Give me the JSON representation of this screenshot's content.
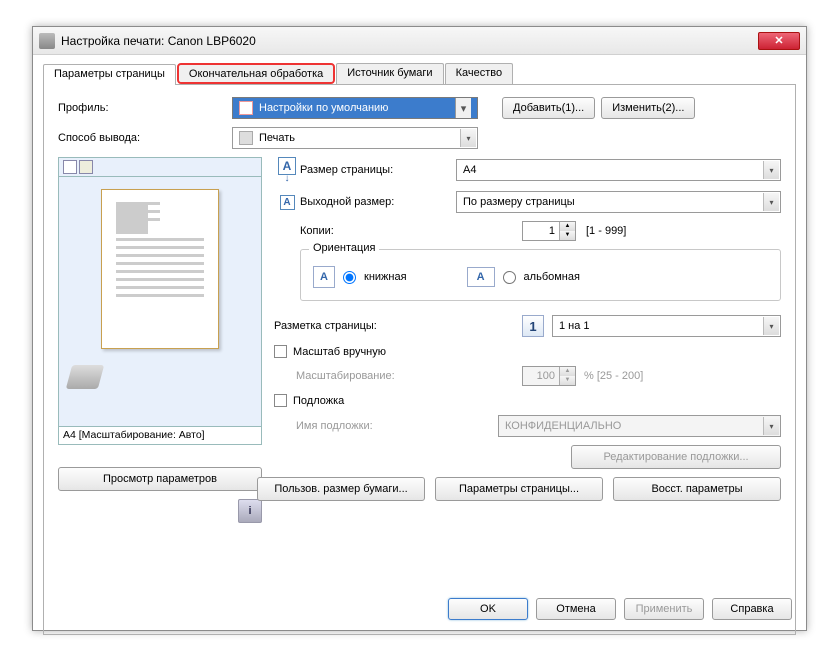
{
  "window": {
    "title": "Настройка печати: Canon LBP6020"
  },
  "tabs": [
    "Параметры страницы",
    "Окончательная обработка",
    "Источник бумаги",
    "Качество"
  ],
  "profile": {
    "label": "Профиль:",
    "value": "Настройки по умолчанию",
    "add_btn": "Добавить(1)...",
    "edit_btn": "Изменить(2)..."
  },
  "output": {
    "label": "Способ вывода:",
    "value": "Печать"
  },
  "preview": {
    "caption": "A4 [Масштабирование: Авто]",
    "view_btn": "Просмотр параметров"
  },
  "page_size": {
    "label": "Размер страницы:",
    "value": "A4"
  },
  "output_size": {
    "label": "Выходной размер:",
    "value": "По размеру страницы"
  },
  "copies": {
    "label": "Копии:",
    "value": "1",
    "range": "[1 - 999]"
  },
  "orientation": {
    "group": "Ориентация",
    "portrait": "книжная",
    "landscape": "альбомная"
  },
  "layout": {
    "label": "Разметка страницы:",
    "icon_num": "1",
    "value": "1 на 1"
  },
  "scale": {
    "check": "Масштаб вручную",
    "label": "Масштабирование:",
    "value": "100",
    "range": "% [25 - 200]"
  },
  "watermark": {
    "check": "Подложка",
    "name_label": "Имя подложки:",
    "value": "КОНФИДЕНЦИАЛЬНО",
    "edit_btn": "Редактирование подложки..."
  },
  "bottom_buttons": {
    "custom_size": "Пользов. размер бумаги...",
    "page_options": "Параметры страницы...",
    "restore": "Восст. параметры"
  },
  "dialog": {
    "ok": "OK",
    "cancel": "Отмена",
    "apply": "Применить",
    "help": "Справка"
  }
}
